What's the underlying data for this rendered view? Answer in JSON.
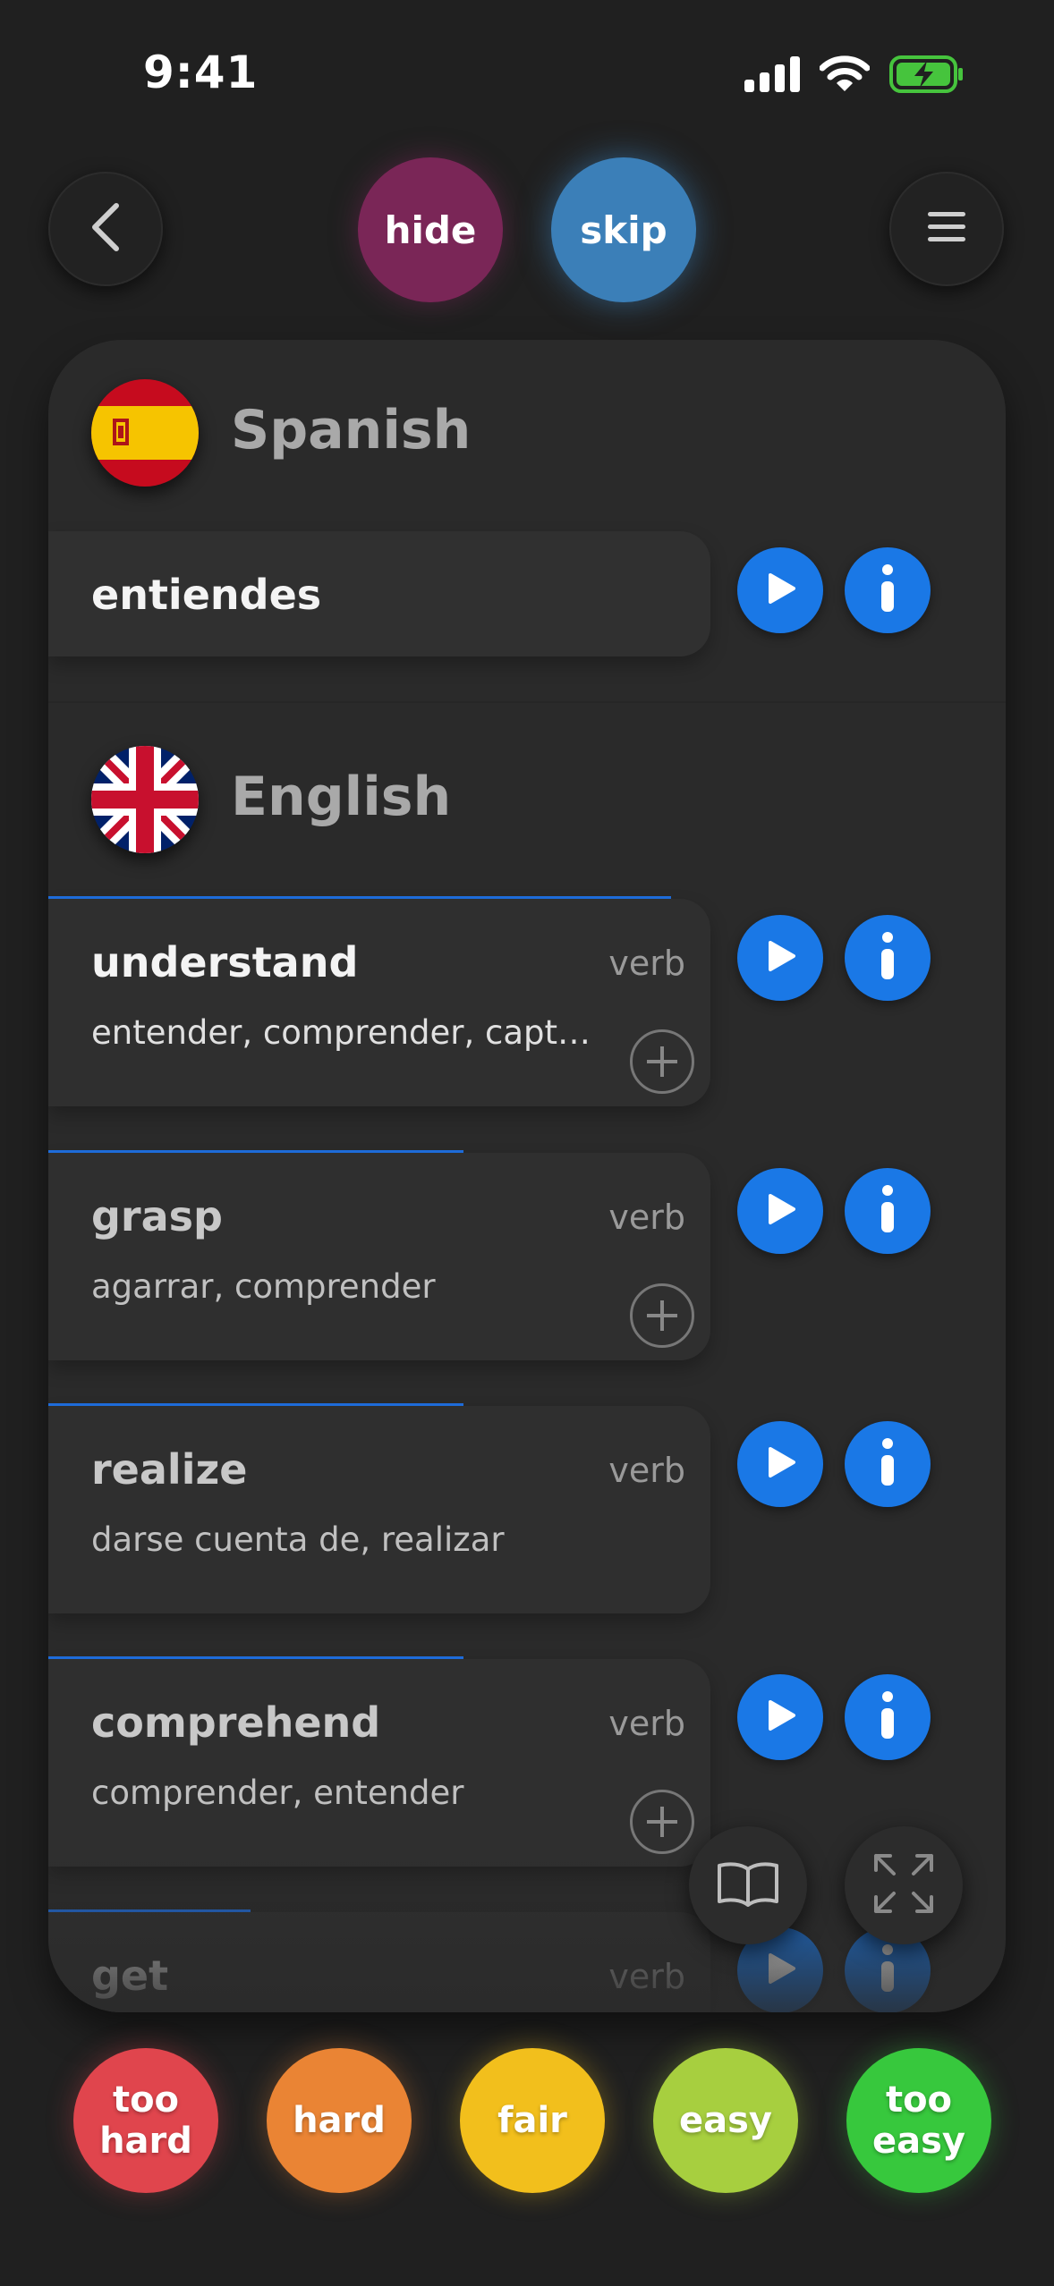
{
  "status": {
    "time": "9:41"
  },
  "top": {
    "hide_label": "hide",
    "skip_label": "skip"
  },
  "source": {
    "language": "Spanish",
    "phrase": "entiendes"
  },
  "target": {
    "language": "English",
    "entries": [
      {
        "word": "understand",
        "pos": "verb",
        "translations": "entender, comprender, capt…",
        "progress": 0.58
      },
      {
        "word": "grasp",
        "pos": "verb",
        "translations": "agarrar, comprender",
        "progress": 0.39
      },
      {
        "word": "realize",
        "pos": "verb",
        "translations": "darse cuenta de, realizar",
        "progress": 0.39
      },
      {
        "word": "comprehend",
        "pos": "verb",
        "translations": "comprender, entender",
        "progress": 0.39
      },
      {
        "word": "get",
        "pos": "verb",
        "translations": "",
        "progress": 0.19
      }
    ]
  },
  "ratings": {
    "too_hard": "too hard",
    "hard": "hard",
    "fair": "fair",
    "easy": "easy",
    "too_easy": "too easy"
  },
  "colors": {
    "hide": "#7a2657",
    "skip": "#3b7fb8",
    "too_hard": "#e0454d",
    "hard": "#ea8434",
    "fair": "#f2bf1c",
    "easy": "#a7cf3f",
    "too_easy": "#37c83d",
    "accent_blue": "#1a78e6"
  }
}
